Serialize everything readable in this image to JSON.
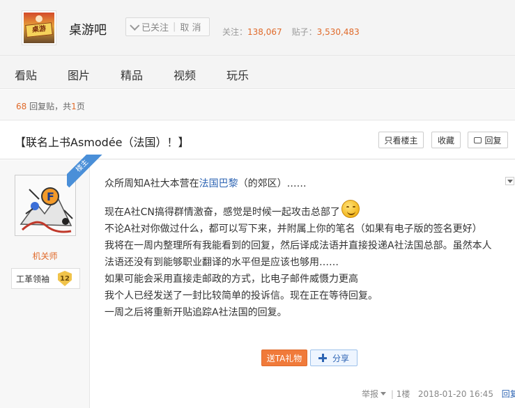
{
  "header": {
    "forum_name": "桌游吧",
    "logo_text": "桌游",
    "follow_status": "已关注",
    "unfollow_label": "取 消",
    "stats": {
      "follow_label": "关注：",
      "follow_count": "138,067",
      "post_label": "贴子：",
      "post_count": "3,530,483"
    }
  },
  "nav": {
    "tabs": [
      "看贴",
      "图片",
      "精品",
      "视频",
      "玩乐"
    ]
  },
  "info_bar": {
    "reply_count": "68",
    "reply_text": "回复贴，共",
    "page_count": "1",
    "page_suffix": "页"
  },
  "thread": {
    "title": "【联名上书Asmodée（法国）！】",
    "buttons": {
      "only_op": "只看楼主",
      "favorite": "收藏",
      "reply": "回复"
    }
  },
  "post": {
    "badge": "楼主",
    "author": "机关师",
    "level_name": "工革领袖",
    "level": "12",
    "body": {
      "line1_pre": "众所周知A社大本营在",
      "line1_link": "法国巴黎",
      "line1_post": "（的郊区）……",
      "line2": "现在A社CN搞得群情激奋，感觉是时候一起攻击总部了",
      "line3": "不论A社对你做过什么，都可以写下来，并附属上你的笔名（如果有电子版的签名更好）",
      "line4": "我将在一周内整理所有我能看到的回复，然后译成法语并直接投递A社法国总部。虽然本人",
      "line5": "法语还没有到能够职业翻译的水平但是应该也够用……",
      "line6": "如果可能会采用直接走邮政的方式，比电子邮件威慑力更高",
      "line7": "我个人已经发送了一封比较简单的投诉信。现在正在等待回复。",
      "line8": "一周之后将重新开贴追踪A社法国的回复。"
    },
    "gift_button": "送TA礼物",
    "share_button": "分享",
    "footer": {
      "report": "举报",
      "floor": "1楼",
      "timestamp": "2018-01-20 16:45",
      "reply": "回复"
    }
  },
  "colors": {
    "accent_orange": "#e06a2a",
    "link_blue": "#2d64b3",
    "badge_blue": "#4a8fd8"
  }
}
